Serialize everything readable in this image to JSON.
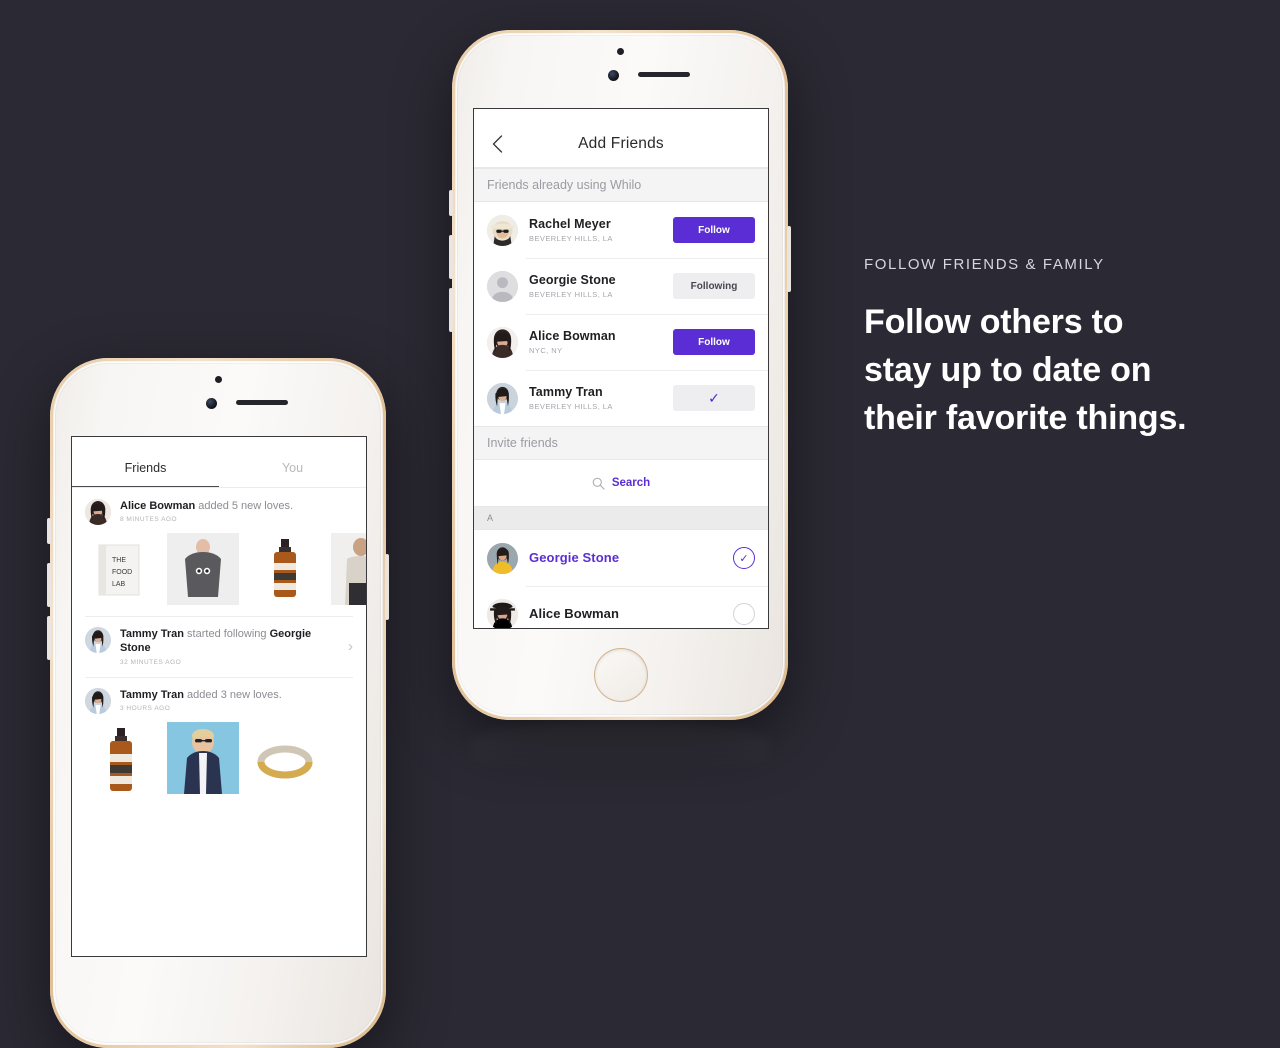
{
  "colors": {
    "background": "#2b2933",
    "accent_purple": "#5a2ed4",
    "pill_grey": "#eeeef0",
    "section_grey": "#f4f4f5",
    "phone_gold": "#e2c096"
  },
  "copy": {
    "eyebrow": "FOLLOW FRIENDS & FAMILY",
    "headline_lines": [
      "Follow others to",
      "stay up to date on",
      "their favorite things."
    ]
  },
  "center_phone": {
    "navbar": {
      "back_icon": "chevron-left-icon",
      "title": "Add Friends"
    },
    "sections": [
      {
        "id": "already",
        "header": "Friends already using Whilo"
      },
      {
        "id": "invite",
        "header": "Invite friends"
      },
      {
        "id": "alpha_a",
        "header": "A"
      }
    ],
    "already_using": [
      {
        "name": "Rachel Meyer",
        "location": "BEVERLEY HILLS, LA",
        "action": "Follow",
        "action_style": "follow",
        "avatar": "woman-hat-sunglasses"
      },
      {
        "name": "Georgie Stone",
        "location": "BEVERLEY HILLS, LA",
        "action": "Following",
        "action_style": "following",
        "avatar": "placeholder-person"
      },
      {
        "name": "Alice Bowman",
        "location": "NYC, NY",
        "action": "Follow",
        "action_style": "follow",
        "avatar": "woman-dark-hair"
      },
      {
        "name": "Tammy Tran",
        "location": "BEVERLEY HILLS, LA",
        "action": "✓",
        "action_style": "check",
        "avatar": "woman-blue-shirt"
      }
    ],
    "search": {
      "icon": "search-icon",
      "label": "Search",
      "placeholder": "Search"
    },
    "contacts": [
      {
        "name": "Georgie Stone",
        "selected": true,
        "avatar": "woman-yellow-sweater"
      },
      {
        "name": "Alice Bowman",
        "selected": false,
        "avatar": "woman-black-hat"
      }
    ]
  },
  "left_phone": {
    "tabs": [
      {
        "label": "Friends",
        "active": true
      },
      {
        "label": "You",
        "active": false
      }
    ],
    "feed": [
      {
        "actor": "Alice Bowman",
        "text": " added 5 new loves.",
        "time": "8 MINUTES AGO",
        "avatar": "woman-dark-hair",
        "chevron": false,
        "tiles": [
          "book-food-lab",
          "grey-sweatshirt",
          "amber-bottle",
          "woman-photo"
        ]
      },
      {
        "actor": "Tammy Tran",
        "text": " started following ",
        "target": "Georgie Stone",
        "time": "32 MINUTES AGO",
        "avatar": "woman-blue-shirt",
        "chevron": true,
        "tiles": []
      },
      {
        "actor": "Tammy Tran",
        "text": " added 3 new loves.",
        "time": "3 HOURS AGO",
        "avatar": "woman-blue-shirt",
        "chevron": false,
        "tiles": [
          "amber-bottle",
          "blue-jacket-portrait",
          "gold-bangle"
        ]
      }
    ]
  }
}
